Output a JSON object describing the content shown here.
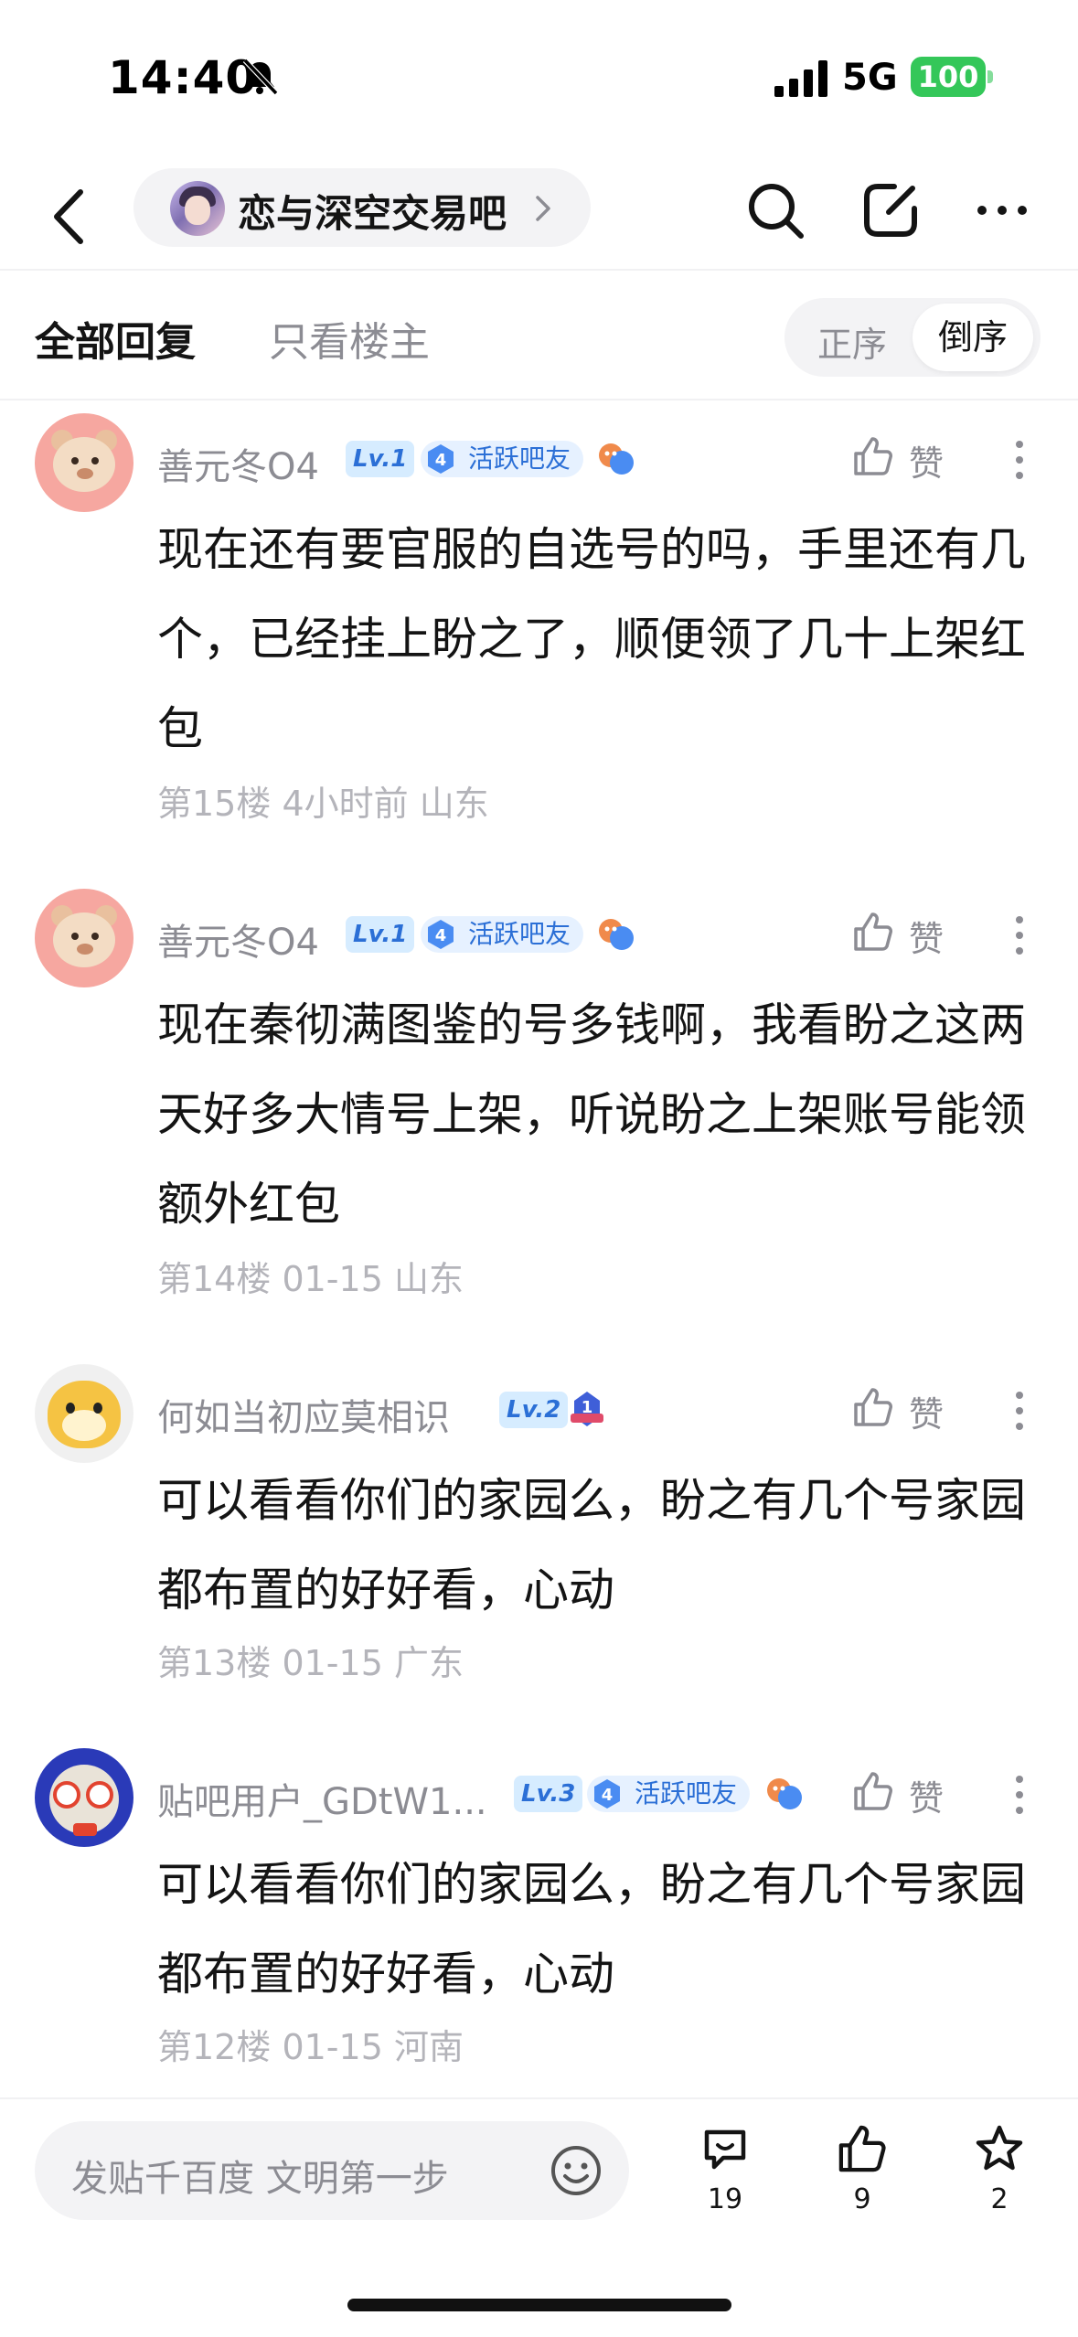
{
  "status_bar": {
    "time": "14:40",
    "network": "5G",
    "battery": "100"
  },
  "nav": {
    "forum_name": "恋与深空交易吧",
    "icons": [
      "back-icon",
      "search-icon",
      "edit-icon",
      "more-icon"
    ]
  },
  "filters": {
    "all_replies": "全部回复",
    "only_op": "只看楼主",
    "sort_asc": "正序",
    "sort_desc": "倒序",
    "selected_sort": "倒序"
  },
  "posts": [
    {
      "username": "善元冬O4",
      "level": "Lv.1",
      "active_badge_level": "4",
      "active_badge_label": "活跃吧友",
      "like_label": "赞",
      "content": "现在还有要官服的自选号的吗，手里还有几个，已经挂上盼之了，顺便领了几十上架红包",
      "floor": "第15楼",
      "time": "4小时前",
      "location": "山东"
    },
    {
      "username": "善元冬O4",
      "level": "Lv.1",
      "active_badge_level": "4",
      "active_badge_label": "活跃吧友",
      "like_label": "赞",
      "content": "现在秦彻满图鉴的号多钱啊，我看盼之这两天好多大情号上架，听说盼之上架账号能领额外红包",
      "floor": "第14楼",
      "time": "01-15",
      "location": "山东"
    },
    {
      "username": "何如当初应莫相识",
      "level": "Lv.2",
      "rank_badge": "1",
      "like_label": "赞",
      "content": "可以看看你们的家园么，盼之有几个号家园都布置的好好看，心动",
      "floor": "第13楼",
      "time": "01-15",
      "location": "广东"
    },
    {
      "username": "贴吧用户_GDtW1...",
      "level": "Lv.3",
      "active_badge_level": "4",
      "active_badge_label": "活跃吧友",
      "like_label": "赞",
      "content": "可以看看你们的家园么，盼之有几个号家园都布置的好好看，心动",
      "floor": "第12楼",
      "time": "01-15",
      "location": "河南"
    }
  ],
  "bottom_bar": {
    "compose_placeholder": "发贴千百度 文明第一步",
    "comment_count": "19",
    "like_count": "9",
    "favorite_count": "2"
  },
  "colors": {
    "accent_blue": "#2b6fd6",
    "badge_bg": "#d6ecff",
    "battery_green": "#34c759",
    "muted_text": "#8c8c93"
  }
}
